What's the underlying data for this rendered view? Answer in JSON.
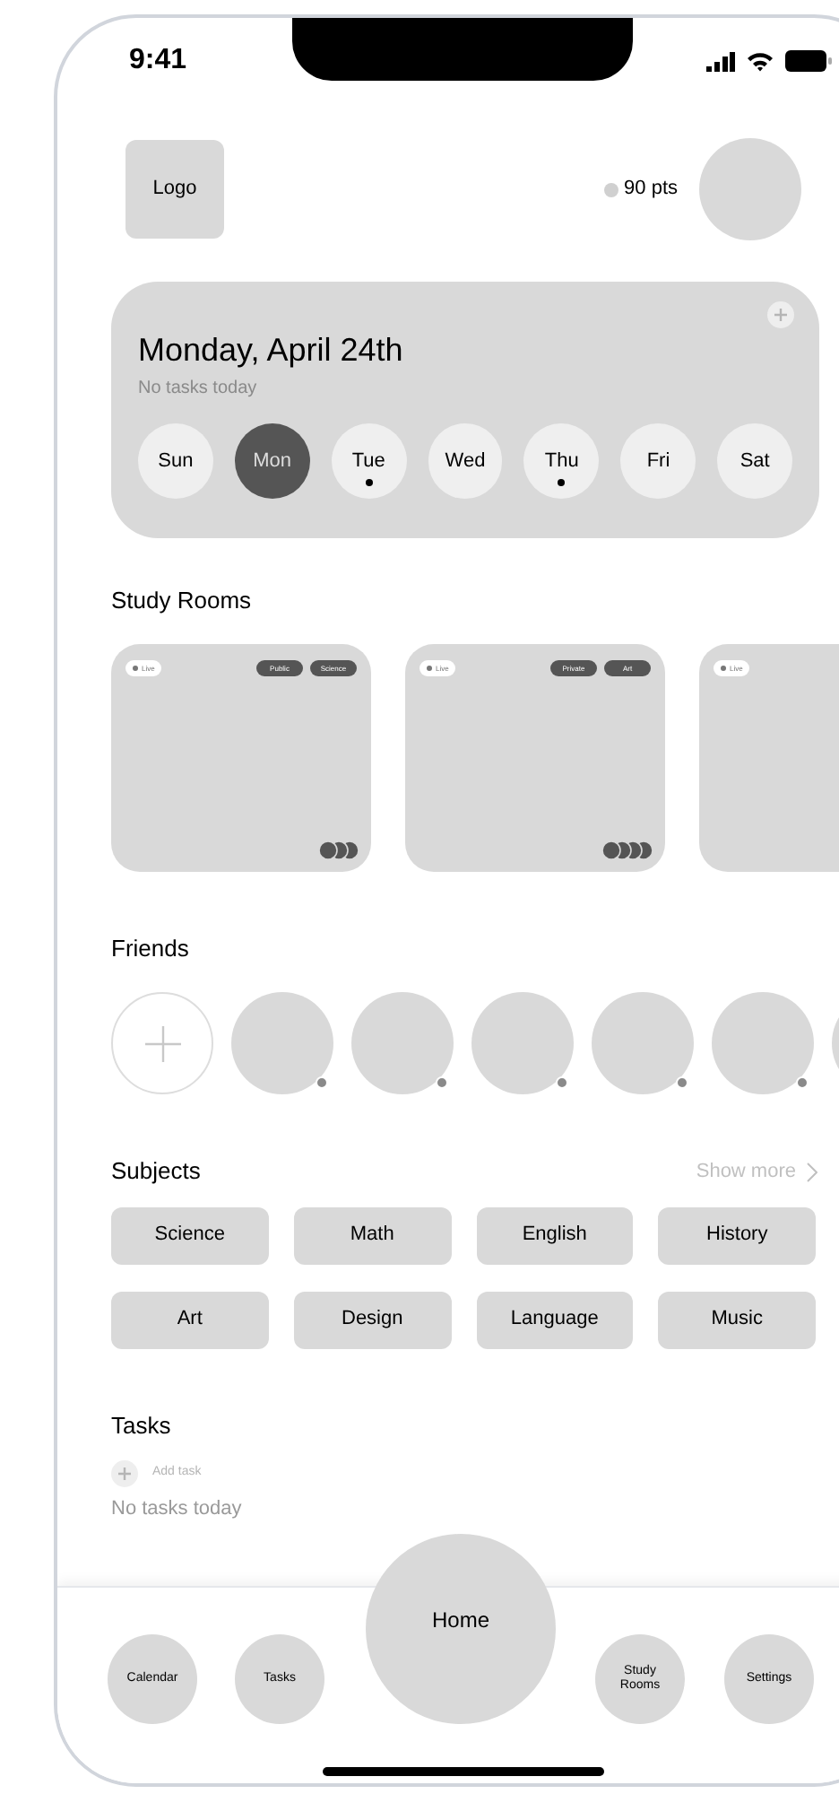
{
  "status_bar": {
    "time": "9:41"
  },
  "header": {
    "logo": "Logo",
    "points": "90 pts"
  },
  "date_card": {
    "title": "Monday, April 24th",
    "subtitle": "No tasks today",
    "days": [
      {
        "label": "Sun",
        "selected": false,
        "has_tasks": false
      },
      {
        "label": "Mon",
        "selected": true,
        "has_tasks": false
      },
      {
        "label": "Tue",
        "selected": false,
        "has_tasks": true
      },
      {
        "label": "Wed",
        "selected": false,
        "has_tasks": false
      },
      {
        "label": "Thu",
        "selected": false,
        "has_tasks": true
      },
      {
        "label": "Fri",
        "selected": false,
        "has_tasks": false
      },
      {
        "label": "Sat",
        "selected": false,
        "has_tasks": false
      }
    ]
  },
  "study_rooms": {
    "title": "Study Rooms",
    "rooms": [
      {
        "status": "Live",
        "tags": [
          "Public",
          "Science"
        ],
        "members": [
          {
            "kind": "avatar"
          },
          {
            "kind": "avatar"
          },
          {
            "kind": "avatar"
          }
        ]
      },
      {
        "status": "Live",
        "tags": [
          "Private",
          "Art"
        ],
        "members": [
          {
            "kind": "avatar"
          },
          {
            "kind": "avatar"
          },
          {
            "kind": "avatar"
          },
          {
            "kind": "avatar"
          }
        ]
      },
      {
        "status": "Live"
      }
    ]
  },
  "friends": {
    "title": "Friends",
    "items": [
      {
        "kind": "add"
      },
      {
        "kind": "avatar"
      },
      {
        "kind": "avatar"
      },
      {
        "kind": "avatar"
      },
      {
        "kind": "avatar"
      },
      {
        "kind": "avatar"
      },
      {
        "kind": "edge"
      }
    ]
  },
  "subjects": {
    "title": "Subjects",
    "show_more": "Show more",
    "items": [
      "Science",
      "Math",
      "English",
      "History",
      "Art",
      "Design",
      "Language",
      "Music"
    ]
  },
  "tasks": {
    "title": "Tasks",
    "add_label": "Add task",
    "empty": "No tasks today"
  },
  "nav": [
    {
      "label": "Calendar",
      "selected": false
    },
    {
      "label": "Tasks",
      "selected": false
    },
    {
      "label": "Home",
      "selected": true
    },
    {
      "label": "Study Rooms",
      "selected": false
    },
    {
      "label": "Settings",
      "selected": false
    }
  ]
}
